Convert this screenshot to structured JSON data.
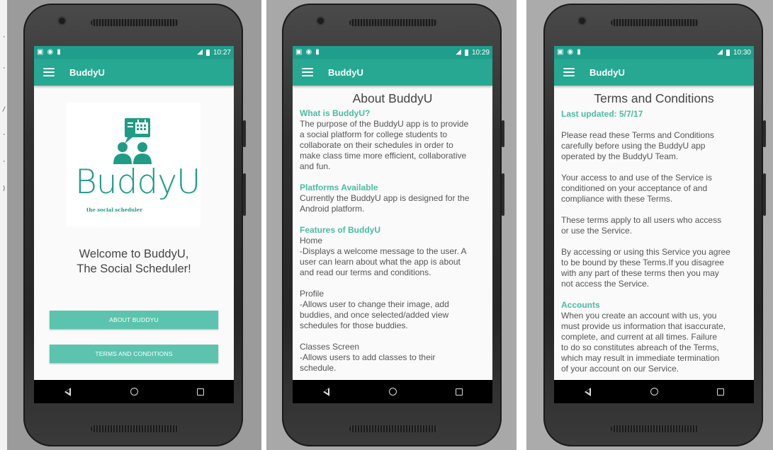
{
  "screens": [
    {
      "status": {
        "time": "10:27"
      },
      "appbar": {
        "title": "BuddyU"
      },
      "logo": {
        "wordmark": "BuddyU",
        "tagline": "the social scheduler"
      },
      "welcome": [
        "Welcome to BuddyU,",
        "The Social Scheduler!"
      ],
      "buttons": {
        "about": "ABOUT BUDDYU",
        "terms": "TERMS AND CONDITIONS"
      }
    },
    {
      "status": {
        "time": "10:29"
      },
      "appbar": {
        "title": "BuddyU"
      },
      "title": "About BuddyU",
      "sections": [
        {
          "heading": "What is BuddyU?",
          "lines": [
            "The purpose of the BuddyU app is to provide",
            "a social platform for college students to",
            "collaborate on their schedules in order to",
            "make class time more efficient, collaborative",
            "and fun."
          ]
        },
        {
          "heading": "Platforms Available",
          "lines": [
            "Currently the BuddyU app is designed for the",
            "Android platform."
          ]
        },
        {
          "heading": "Features of BuddyU",
          "lines": [
            "Home",
            "-Displays a welcome message to the user. A",
            "user can learn about what the app is about",
            "and read our terms and conditions.",
            "",
            "Profile",
            "-Allows user to change their image, add",
            "buddies, and once selected/added view",
            "schedules for those buddies.",
            "",
            "Classes Screen",
            "-Allows users to add classes to their",
            "schedule."
          ]
        }
      ]
    },
    {
      "status": {
        "time": "10:30"
      },
      "appbar": {
        "title": "BuddyU"
      },
      "title": "Terms and Conditions",
      "updated": "Last updated: 5/7/17",
      "paragraphs": [
        [
          "Please read these Terms and Conditions",
          "carefully before using the BuddyU app",
          "operated by the BuddyU Team."
        ],
        [
          "Your access to and use of the Service is",
          "conditioned on your acceptance of and",
          "compliance with these Terms."
        ],
        [
          "These terms apply to all users who access",
          "or use the Service."
        ],
        [
          "By accessing or using this Service you agree",
          "to be bound by these Terms.If you disagree",
          "with any part of these terms then you may",
          "not access the Service."
        ]
      ],
      "accounts": {
        "heading": "Accounts",
        "lines": [
          "When you create an account with us, you",
          "must provide us information that isaccurate,",
          "complete, and current at all times. Failure",
          "to do so constitutes abreach of the Terms,",
          "which may result in immediate termination",
          "of your account on our Service."
        ]
      }
    }
  ],
  "colors": {
    "statusbar": "#1f9e8c",
    "appbar": "#26a892",
    "accent": "#5cc4ae",
    "heading": "#4bbba3"
  }
}
